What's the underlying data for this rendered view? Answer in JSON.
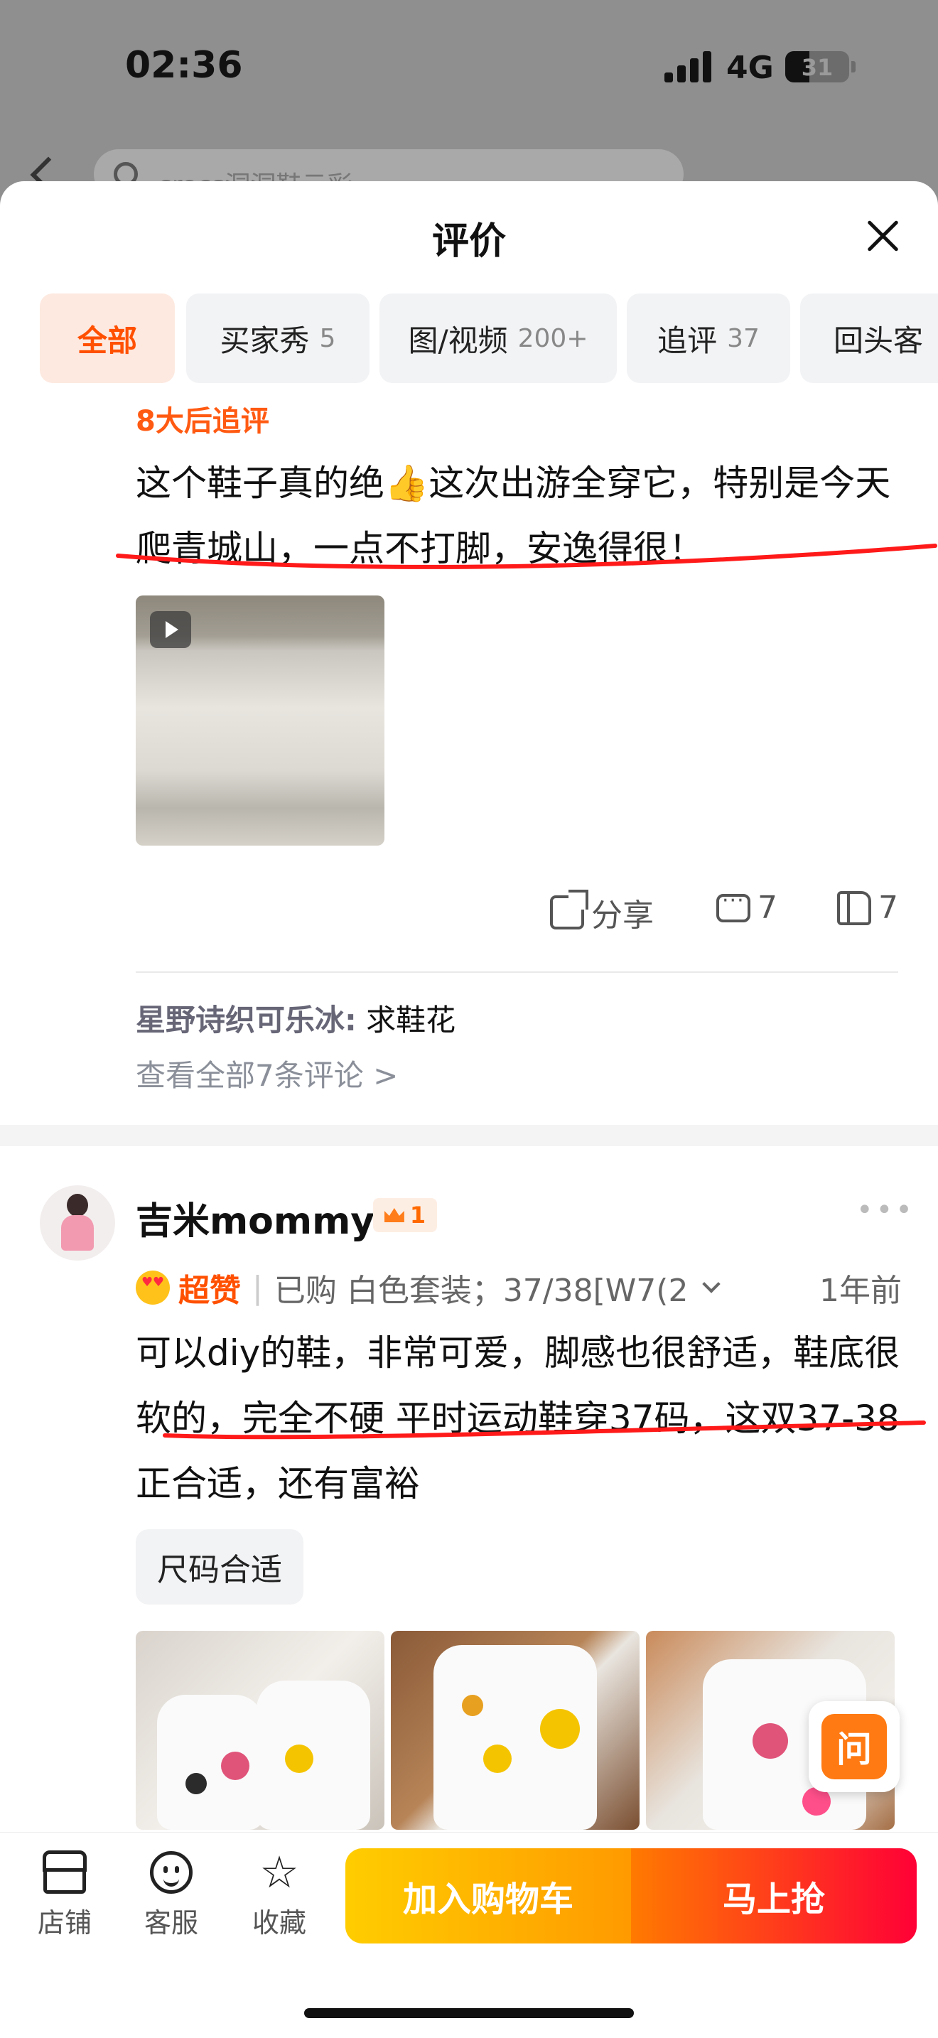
{
  "status": {
    "time": "02:36",
    "network": "4G",
    "battery": "31"
  },
  "background_page": {
    "search_placeholder": "crocs洞洞鞋云彩"
  },
  "sheet": {
    "title": "评价",
    "tabs": [
      {
        "label": "全部",
        "count": ""
      },
      {
        "label": "买家秀",
        "count": "5"
      },
      {
        "label": "图/视频",
        "count": "200+"
      },
      {
        "label": "追评",
        "count": "37"
      },
      {
        "label": "回头客",
        "count": ""
      }
    ]
  },
  "review1": {
    "followup_label": "8大后追评",
    "text": "这个鞋子真的绝👍这次出游全穿它，特别是今天爬青城山，一点不打脚，安逸得很！",
    "share_label": "分享",
    "comment_count": "7",
    "like_count": "7",
    "comment": {
      "name": "星野诗织可乐冰:",
      "text": "求鞋花"
    },
    "view_all": "查看全部7条评论 >"
  },
  "review2": {
    "username": "吉米mommy",
    "level": "1",
    "rating": "超赞",
    "sku": "已购 白色套装；37/38[W7(2",
    "time": "1年前",
    "text": "可以diy的鞋，非常可爱，脚感也很舒适，鞋底很软的，完全不硬 平时运动鞋穿37码，这双37-38正合适，还有富裕",
    "tag": "尺码合适"
  },
  "ask_button": "问",
  "bottom_bar": {
    "store": "店铺",
    "service": "客服",
    "favorite": "收藏",
    "add_to_cart": "加入购物车",
    "buy_now": "马上抢"
  },
  "colors": {
    "accent": "#ff5000",
    "annotation_red": "#ff1a1a"
  }
}
